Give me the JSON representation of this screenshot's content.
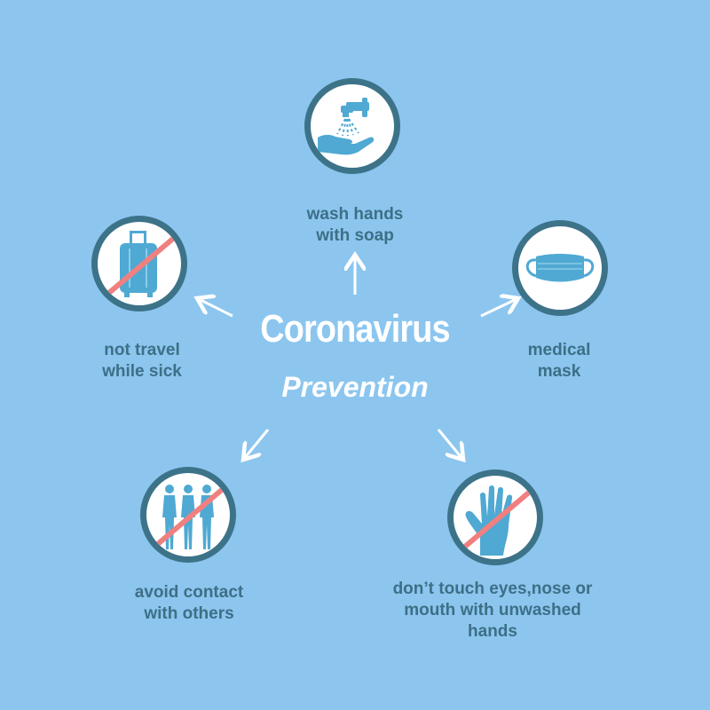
{
  "title": {
    "main": "Coronavirus",
    "sub": "Prevention"
  },
  "items": [
    {
      "caption": [
        "wash hands",
        "with soap"
      ],
      "icon": "hand-wash-faucet-icon",
      "prohibited": false
    },
    {
      "caption": [
        "medical",
        "mask"
      ],
      "icon": "medical-mask-icon",
      "prohibited": false
    },
    {
      "caption": [
        "don’t touch eyes,nose or",
        "mouth with unwashed",
        "hands"
      ],
      "icon": "hand-icon",
      "prohibited": true
    },
    {
      "caption": [
        "avoid contact",
        "with others"
      ],
      "icon": "people-icon",
      "prohibited": true
    },
    {
      "caption": [
        "not travel",
        "while sick"
      ],
      "icon": "suitcase-icon",
      "prohibited": true
    }
  ],
  "colors": {
    "background": "#8cc6ef",
    "ring": "#3d7389",
    "icon": "#4fa9d3",
    "prohibition": "#f08080",
    "caption": "#3d6f86",
    "title": "#ffffff"
  }
}
